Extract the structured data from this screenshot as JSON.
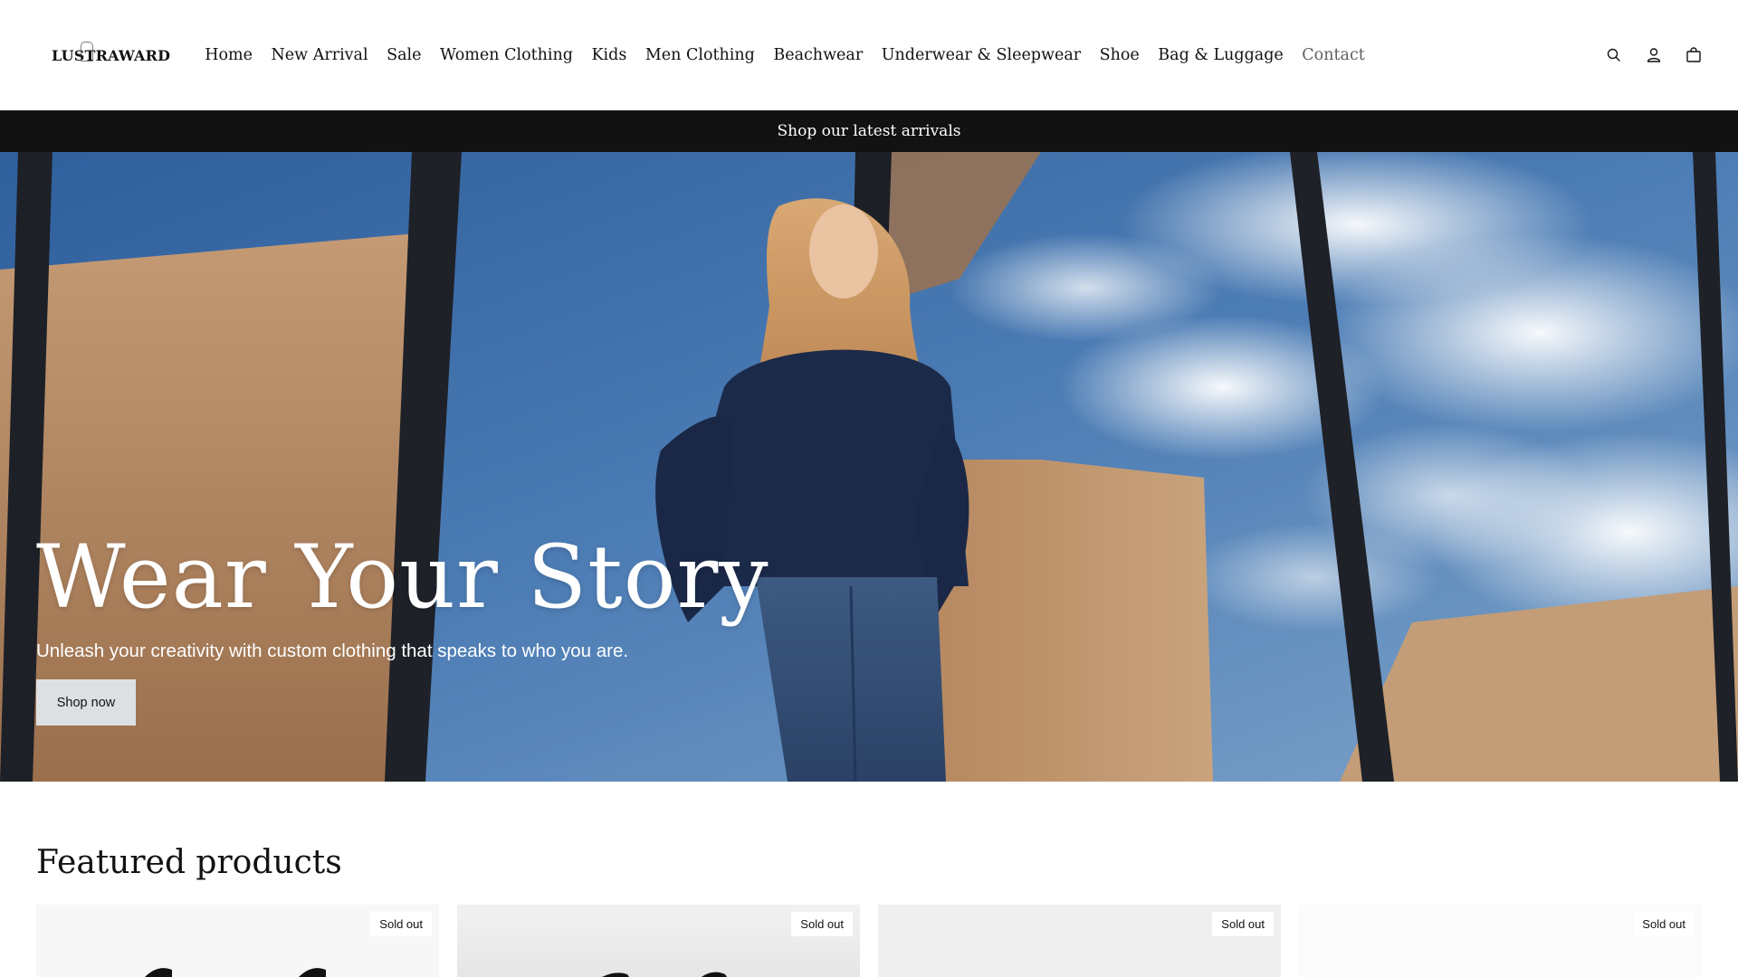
{
  "header": {
    "logo": "LUSTRAWARD",
    "nav": [
      {
        "label": "Home"
      },
      {
        "label": "New Arrival"
      },
      {
        "label": "Sale"
      },
      {
        "label": "Women Clothing"
      },
      {
        "label": "Kids"
      },
      {
        "label": "Men Clothing"
      },
      {
        "label": "Beachwear"
      },
      {
        "label": "Underwear & Sleepwear"
      },
      {
        "label": "Shoe"
      },
      {
        "label": "Bag & Luggage"
      },
      {
        "label": "Contact"
      }
    ],
    "icons": [
      "search-icon",
      "account-icon",
      "cart-icon"
    ]
  },
  "announcement": {
    "text": "Shop our latest arrivals"
  },
  "hero": {
    "title": "Wear Your Story",
    "subtitle": "Unleash your creativity with custom clothing that speaks to who you are.",
    "button_label": "Shop now"
  },
  "featured": {
    "title": "Featured products",
    "products": [
      {
        "badge": "Sold out"
      },
      {
        "badge": "Sold out"
      },
      {
        "badge": "Sold out"
      },
      {
        "badge": "Sold out"
      }
    ]
  },
  "colors": {
    "text": "#121212",
    "announcement_bg": "#121212",
    "button_bg": "#dde0e3",
    "sky": "#4a77ad",
    "wall": "#b48a64"
  }
}
